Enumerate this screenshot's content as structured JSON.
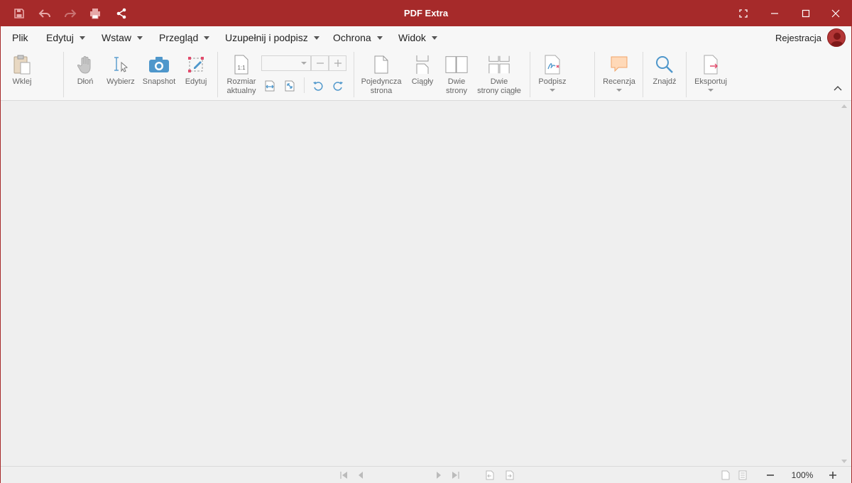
{
  "app": {
    "title": "PDF Extra"
  },
  "quick_access": [
    {
      "name": "save-icon"
    },
    {
      "name": "undo-icon"
    },
    {
      "name": "redo-icon"
    },
    {
      "name": "print-icon"
    },
    {
      "name": "share-icon"
    }
  ],
  "window_controls": [
    "fullscreen-icon",
    "minimize-icon",
    "maximize-icon",
    "close-icon"
  ],
  "menu": {
    "items": [
      {
        "label": "Plik",
        "dropdown": false
      },
      {
        "label": "Edytuj",
        "dropdown": true
      },
      {
        "label": "Wstaw",
        "dropdown": true
      },
      {
        "label": "Przegląd",
        "dropdown": true
      },
      {
        "label": "Uzupełnij i podpisz",
        "dropdown": true
      },
      {
        "label": "Ochrona",
        "dropdown": true
      },
      {
        "label": "Widok",
        "dropdown": true
      }
    ],
    "register_label": "Rejestracja"
  },
  "toolbar": {
    "paste": "Wklej",
    "hand": "Dłoń",
    "select": "Wybierz",
    "snapshot": "Snapshot",
    "edit": "Edytuj",
    "actual_size_line1": "Rozmiar",
    "actual_size_line2": "aktualny",
    "actual_size_icon_text": "1:1",
    "zoom_value": "",
    "single_page_line1": "Pojedyncza",
    "single_page_line2": "strona",
    "continuous": "Ciągły",
    "two_pages_line1": "Dwie",
    "two_pages_line2": "strony",
    "two_pages_cont_line1": "Dwie",
    "two_pages_cont_line2": "strony ciągłe",
    "sign": "Podpisz",
    "review": "Recenzja",
    "find": "Znajdź",
    "export": "Eksportuj"
  },
  "status": {
    "zoom": "100%"
  },
  "colors": {
    "brand": "#a62a2a",
    "accent_blue": "#3f8fc4",
    "toolbar_bg": "#f7f7f7",
    "content_bg": "#efefef"
  }
}
